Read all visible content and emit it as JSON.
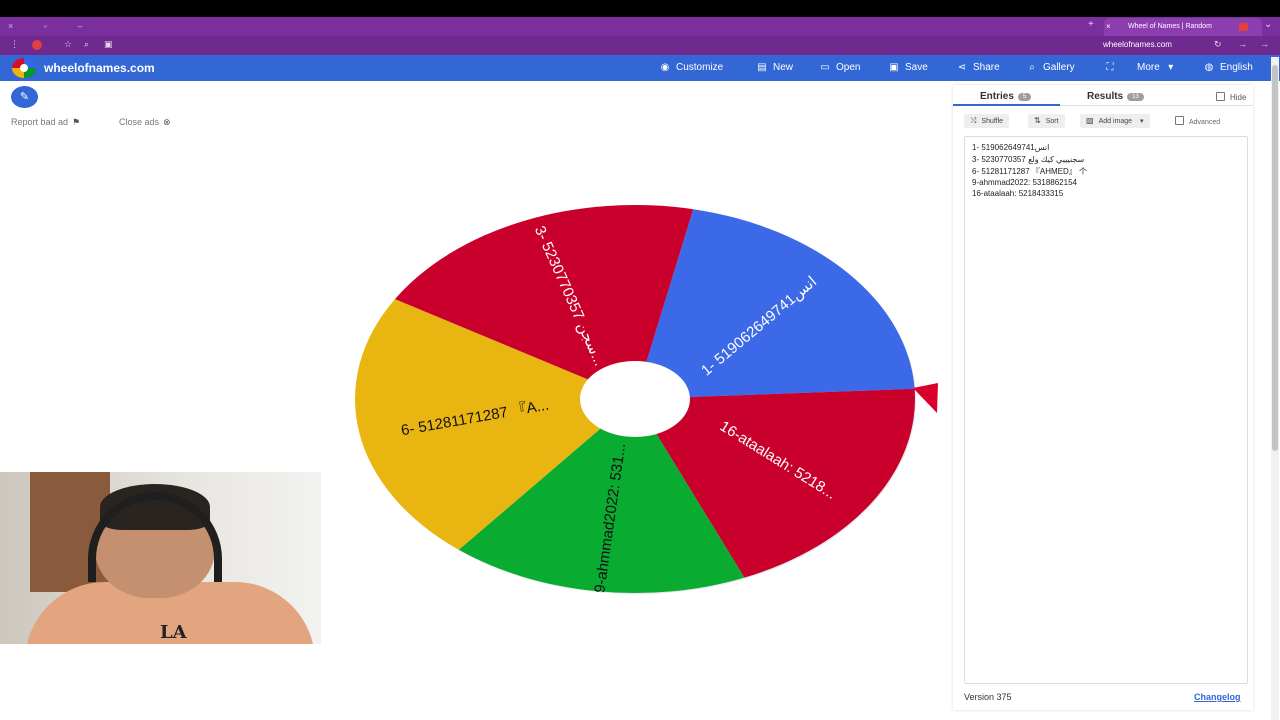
{
  "browser": {
    "tab_title": "Wheel of Names | Random",
    "url": "wheelofnames.com"
  },
  "app": {
    "site_name": "wheelofnames.com",
    "nav": {
      "customize": "Customize",
      "new": "New",
      "open": "Open",
      "save": "Save",
      "share": "Share",
      "gallery": "Gallery",
      "more": "More",
      "language": "English"
    }
  },
  "ads": {
    "report_bad_ad": "Report bad ad",
    "close_ads": "Close ads"
  },
  "wheel": {
    "colors": {
      "red": "#c9002b",
      "blue": "#3c69e7",
      "yellow": "#e9b611",
      "green": "#0aab31",
      "pointer": "#d9002b"
    },
    "slices": [
      {
        "label": "1- 519062649741انس",
        "color": "#3c69e7"
      },
      {
        "label": "16-ataalaah: 5218...",
        "color": "#c9002b"
      },
      {
        "label": "9-ahmmad2022: 531...",
        "color": "#0aab31"
      },
      {
        "label": "6- 51281171287 『A...",
        "color": "#e9b611"
      },
      {
        "label": "3- 5230770357 سجن...",
        "color": "#c9002b"
      }
    ]
  },
  "panel": {
    "tabs": {
      "entries_label": "Entries",
      "entries_count": "5",
      "results_label": "Results",
      "results_count": "13"
    },
    "hide_label": "Hide",
    "toolbar": {
      "shuffle": "Shuffle",
      "sort": "Sort",
      "add_image": "Add image",
      "advanced": "Advanced"
    },
    "entries": [
      "1- 519062649741انس",
      "3- 5230770357 سجنيييي كيك ولع",
      "6- 51281171287 『AHMED』 个",
      "9-ahmmad2022: 5318862154",
      "16-ataalaah: 5218433315"
    ],
    "version": "Version 375",
    "changelog": "Changelog"
  }
}
